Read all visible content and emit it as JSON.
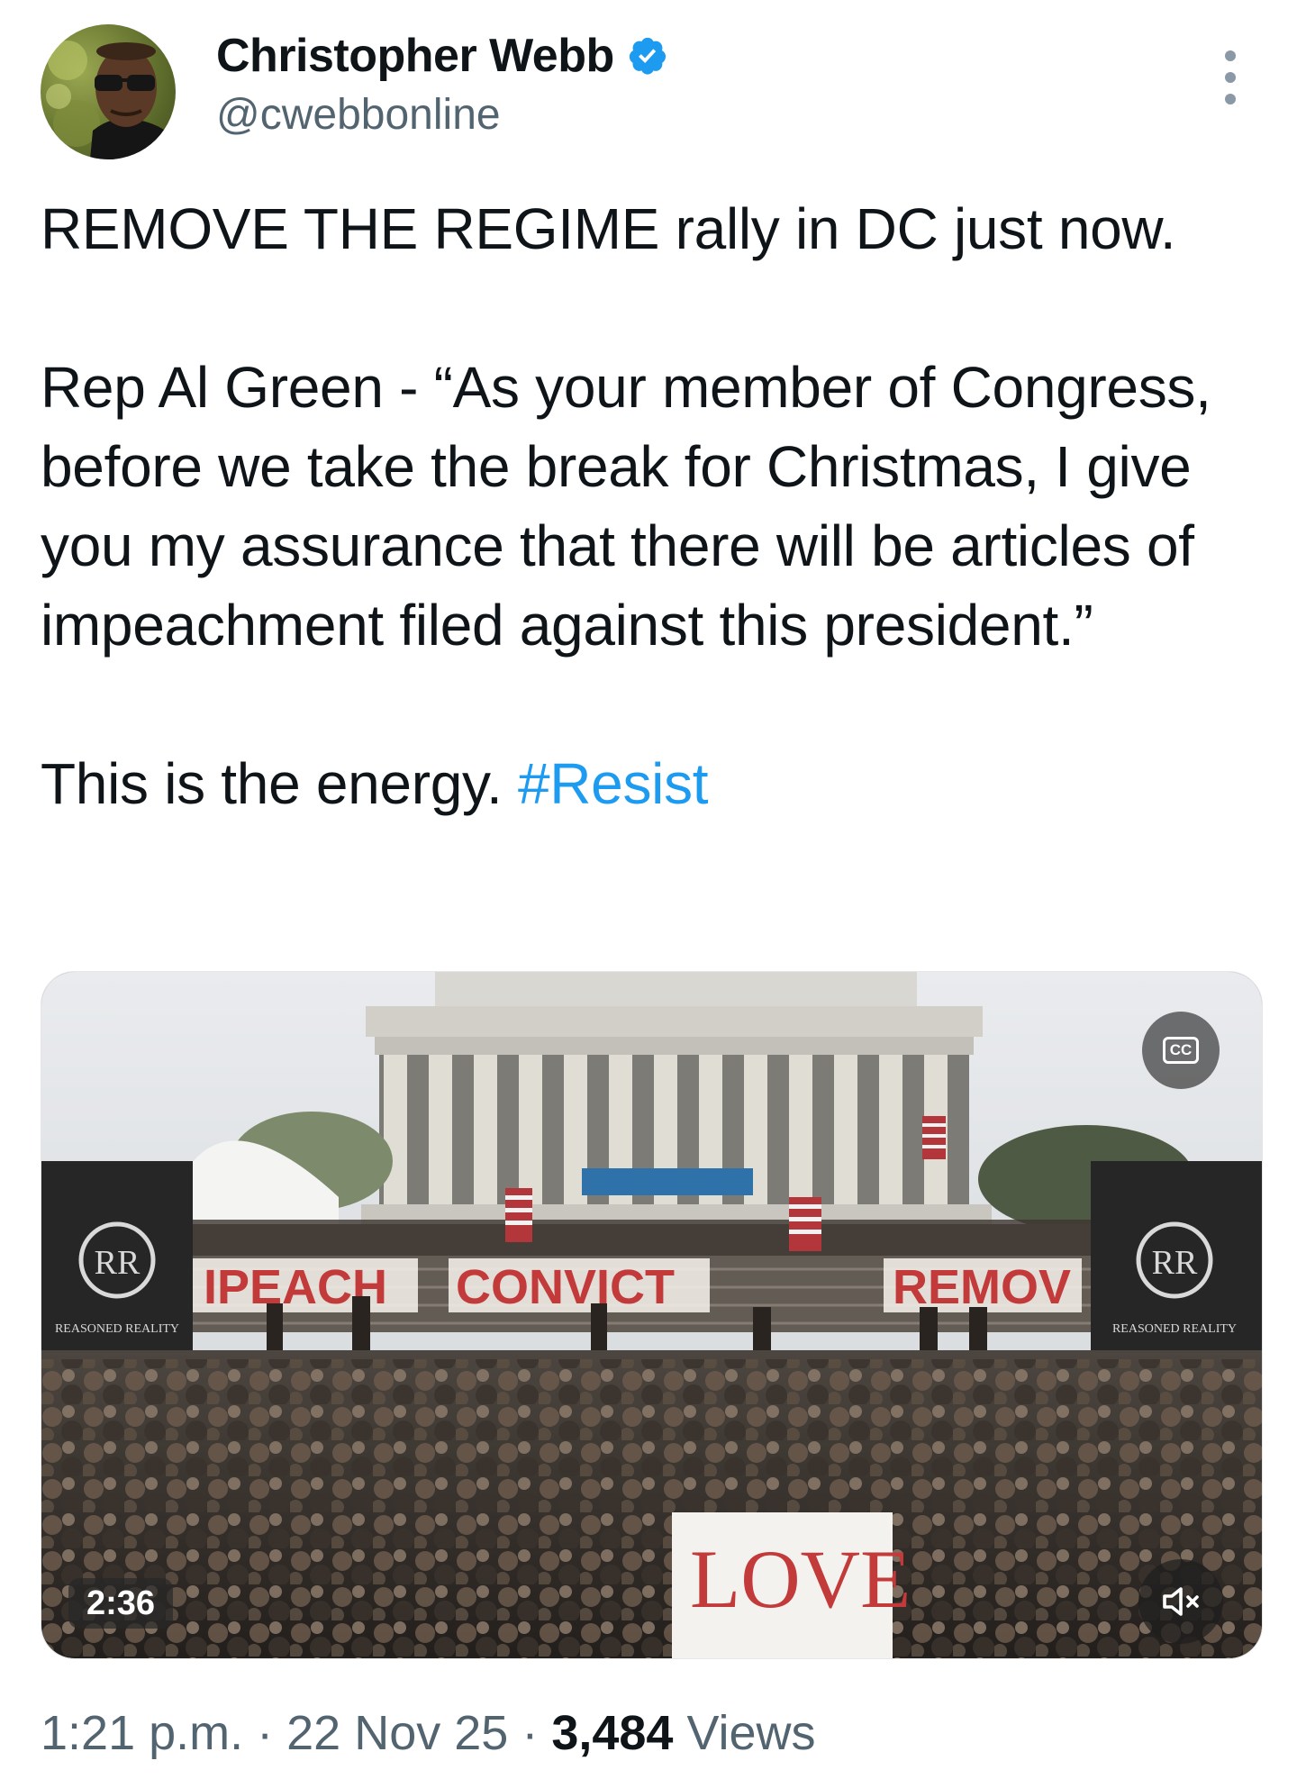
{
  "author": {
    "display_name": "Christopher Webb",
    "handle": "@cwebbonline",
    "verified": true,
    "verified_color": "#1d9bf0"
  },
  "tweet": {
    "line1": "REMOVE THE REGIME rally in DC just now.",
    "quote": "Rep Al Green - “As your member of Congress, before we take the break for Christmas, I give you my assurance that there will be articles of impeachment filed against this president.”",
    "closing": "This is the energy.",
    "hashtag": "#Resist",
    "hashtag_color": "#1d9bf0"
  },
  "media": {
    "type": "video",
    "duration": "2:36",
    "captions_label": "CC",
    "mute_icon": "speaker-muted-icon",
    "scene_signs": {
      "impeach": "IPEACH",
      "convict": "CONVICT",
      "remove": "REMOV",
      "love": "LOVE",
      "banner_left": "RR",
      "banner_right": "RR",
      "banner_caption_left": "REASONED REALITY",
      "banner_caption_right": "REASONED REALITY"
    }
  },
  "meta": {
    "time": "1:21 p.m.",
    "date": "22 Nov 25",
    "separator": "·",
    "views_count": "3,484",
    "views_label": "Views"
  },
  "more_icon": "more-vertical-icon"
}
